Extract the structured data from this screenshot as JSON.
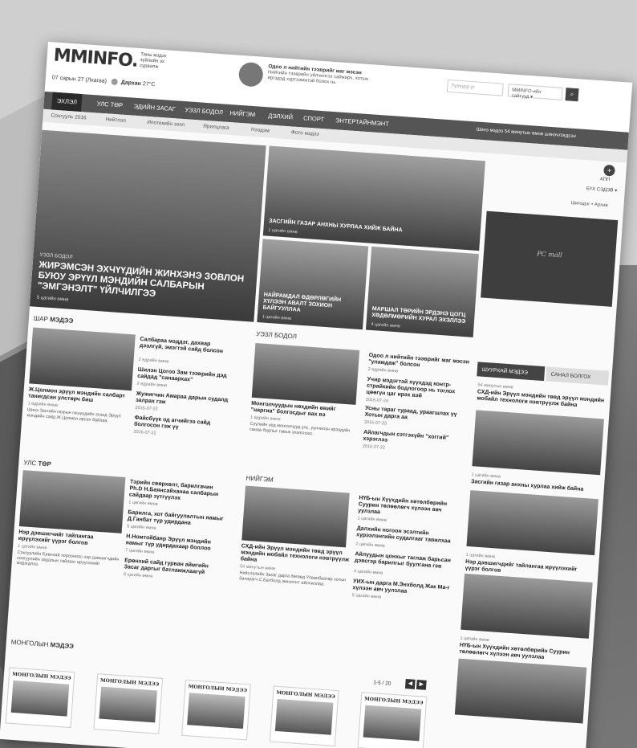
{
  "site": {
    "logo": "MMINFO.",
    "logo_tagline": "Таны мэдэх зүйлийн эх сурвалж",
    "date": "07 сарын 27 (Лхагва)",
    "weather_city": "Дархан",
    "temperature": "27°C",
    "promo_title": "Одоо л нийтийн тээврийг маг мэсэн",
    "promo_text": "Нийтийн тээврийн үйлчилгээ сайжирч, хотын иргэдэд хүртээмжтэй болох нь",
    "search_placeholder": "Түлхүүр үг",
    "site_select": "MMINFO-ийн сайтууд",
    "search_icon": "search-icon"
  },
  "nav": {
    "items": [
      "ЭХЛЭЛ",
      "УЛС ТӨР",
      "ЭДИЙН ЗАСАГ",
      "УЭЗЛ БОДОЛ",
      "НИЙГЭМ",
      "ДЭЛХИЙ",
      "СПОРТ",
      "ЭНТЕРТАЙНМЭНТ"
    ],
    "note": "Шинэ мэдээ 54 минутын өмнө шинэчлэгдсэн"
  },
  "subnav": [
    "Сонгууль 2016",
    "Нийтлэл",
    "Ипотекийн зээл",
    "Ярилцлага",
    "Нээдэм",
    "Фото мэдээ"
  ],
  "side_labels": {
    "app": "АПП",
    "all": "БҮХ СЭДЭВ",
    "weather": "Шинэдэг • Архив"
  },
  "hero": {
    "category": "УЭЗЛ БОДОЛ",
    "title": "ЖИРЭМСЭН ЭХЧҮҮДИЙН ЖИНХЭНЭ ЗОВЛОН БУЮУ ЭРҮҮЛ МЭНДИЙН САЛБАРЫН \"ЭМГЭНЭЛТ\" ҮЙЛЧИЛГЭЭ",
    "meta": "5 цагийн өмнө"
  },
  "cards": [
    {
      "title": "ЗАСГИЙН ГАЗАР АНХНЫ ХУРЛАА ХИЙЖ БАЙНА",
      "meta": "1 цагийн өмнө"
    },
    {
      "title": "НАЙРАМДАЛ ӨДӨРЛӨГИЙН ХҮЛЭЭН АВАЛТ ЗОХИОН БАЙГУУЛЛАА",
      "meta": "1 цагийн өмнө"
    },
    {
      "title": "МАРШАЛ ТӨРИЙН ЭРДЭНЭ ЦОГЦ ХӨДӨЛМӨРИЙН ХУРАЛ ЭХЭЛЛЭЭ",
      "meta": "4 цагийн өмнө"
    }
  ],
  "ad": {
    "text": "PC mall"
  },
  "shar": {
    "title_light": "ШАР",
    "title_bold": "МЭДЭЭ",
    "lead_title": "Ж.Цолмон эрүүл мэндийн салбарт танигдсан улстөрч биш",
    "lead_meta": "1 өдрийн өмнө",
    "lead_text": "Шинэ Засгийн газрын гишүүдийн эхэнд Эрүүл мэндийн сайд Ж.Цолмон ирсэн байлаа.",
    "items": [
      {
        "title": "Салбараа мэддэг, дахвар дээлгүй, эмэгтэй сайд болсон",
        "meta": "2 өдрийн өмнө"
      },
      {
        "title": "Шилэн Цогоо Зам тээврийн дэд сайдад \"санаархах\"",
        "meta": "2 өдрийн өмнө"
      },
      {
        "title": "Жужигчин Амараа дарын судалд залрах гэж",
        "meta": "2016-07-22"
      },
      {
        "title": "Файсбүүк од агчийгээ сайд болгосон гэж үү",
        "meta": "2016-07-22"
      }
    ]
  },
  "uzel": {
    "title": "УЭЗЛ БОДОЛ",
    "lead_title": "Монголчуудын нөхдийн өвийг \"наргиа\" болгосдыг яах вэ",
    "lead_meta": "1 өдрийн өмнө",
    "lead_text": "Сүүлийн үед монголчууд улс, үүнчилэн ирээдүйн санаа бодлыг тавьж эхэлснээс.",
    "items": [
      {
        "title": "Одоо л нийтийн тээврийг маг мэсэн \"уламдаж\" болсон",
        "meta": "2 өдрийн өмнө"
      },
      {
        "title": "Учир мэдэгтэй хүүхдэд контр-страйкийн бодлогоор нь тоглох цөөгүн цаг ирэх вэй",
        "meta": "2016-07-24"
      },
      {
        "title": "Усны тараг тураад, ураагшлах үү Хотын дарга аа",
        "meta": "2016-07-23"
      },
      {
        "title": "Айлагчдын сэтгэхүйн \"хоггий\" хэрэглээ",
        "meta": "2016-07-22"
      }
    ]
  },
  "uls": {
    "title_light": "УЛС",
    "title_bold": "ТӨР",
    "lead_title": "Нэр дэвшигчийг тайлангаа ирүүлэхийг үүрэг болгов",
    "lead_meta": "1 цагийн өмнө",
    "lead_text": "Сонгуулийн Ерөнхий хорооноос нэр дэвшигчдийн сонгуулийн зардлын тайланг ирүүлэхийг мэдэгдлээ.",
    "items": [
      {
        "title": "Тэрийн сөөрхөлт, барилгачин Ph.D Н.Баянсайханаа салбарын сайдаар зүтгүүлэх",
        "meta": "1 цагийн өмнө"
      },
      {
        "title": "Барилга, хот байгуулалтын яамыг Д.Ганбат түр удирдана",
        "meta": "5 цагийн өмнө"
      },
      {
        "title": "Н.Номтойбаяр Эрүүл мэндийн яамыг түр удирдахаар боллоо",
        "meta": "7 цагийн өмнө"
      },
      {
        "title": "Ерөнхий сайд гурван аймгийн Засаг даргыг батламжлаагүй",
        "meta": "8 цагийн өмнө"
      }
    ]
  },
  "niigem": {
    "title": "НИЙГЭМ",
    "lead_title": "СХД-ийн Эрүүл мэндийн төвд эрүүл мэндийн мобайл технологи нэвтрүүлж байна",
    "lead_meta": "54 минутын өмнө",
    "lead_text": "Нийслэлийн Засаг дарга бөгөөд Улаанбаатар хотын Захирагч С.Батболд эмнэлэгт айлчиллаа.",
    "items": [
      {
        "title": "НҮБ-ын Хүүхдийн хөтөлбөрийн Суурин төлөөлөгч хүлээн авч уулзлаа",
        "meta": "1 цагийн өмнө"
      },
      {
        "title": "Далхийн ногоон эсэлтийн хурээлэнгийн судалгааг тавилхаа",
        "meta": "2 цагийн өмнө"
      },
      {
        "title": "Айлуудын цонхыг таглаж барьсан дэвсгэр барилгыг буулгана гэв",
        "meta": "4 цагийн өмнө"
      },
      {
        "title": "УИХ-ын дарга М.Энхболд Жак Ма-г хүлээн авч уулзлаа",
        "meta": "5 цагийн өмнө"
      }
    ]
  },
  "sidebar": {
    "tab_on": "ШУУРХАЙ МЭДЭЭ",
    "tab_off": "САНАЛ БОЛГОХ",
    "items": [
      {
        "meta": "54 минутын өмнө",
        "title": "СХД-ийн Эрүүл мэндийн төвд эрүүл мэндийн мобайл технологи нэвтрүүлж байна"
      },
      {
        "meta": "1 цагийн өмнө",
        "title": "Засгийн газар анхны хурлаа хийж байна"
      },
      {
        "meta": "1 цагийн өмнө",
        "title": "Нэр дэвшигчдийг тайлангаа ирүүлэхийг үүрэг болгов"
      },
      {
        "meta": "1 цагийн өмнө",
        "title": "НҮБ-ын Хүүхдийн хөтөлбөрийн Суурин төлөөлөгч хүлээн авч уулзлаа"
      }
    ]
  },
  "mongol": {
    "title_light": "МОНГОЛЫН",
    "title_bold": "МЭДЭЭ",
    "pager": "1-5 / 20",
    "paper_name": "МОНГОЛЫН МЭДЭЭ"
  }
}
